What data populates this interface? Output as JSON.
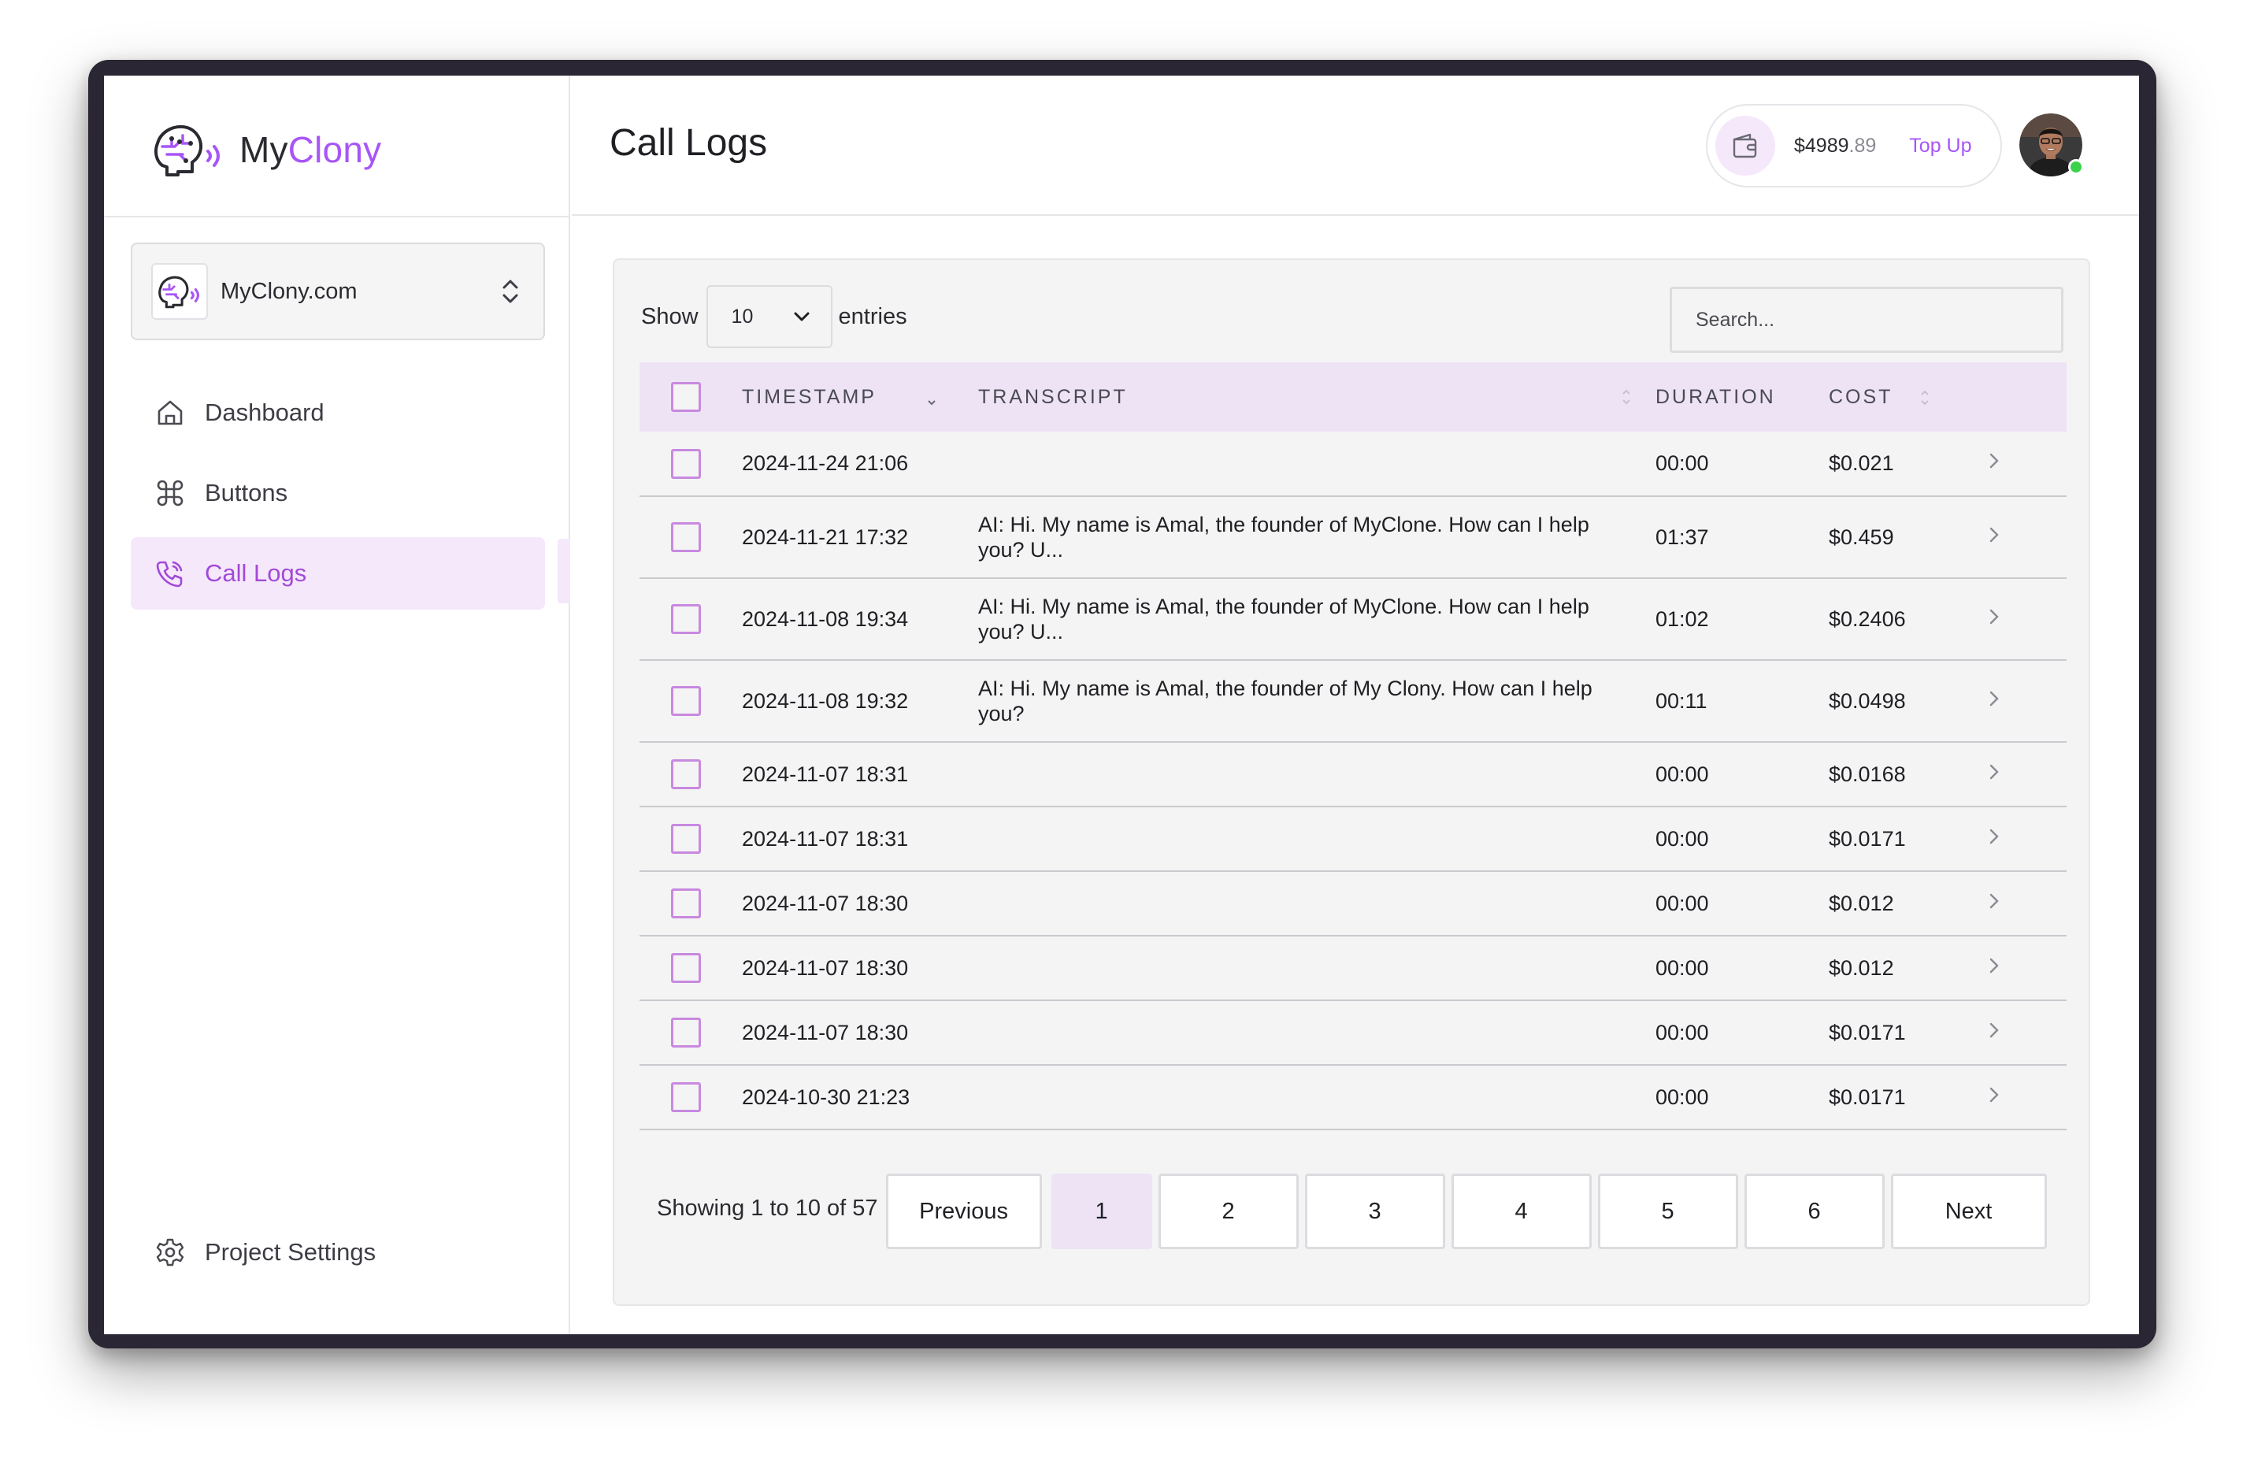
{
  "app": {
    "brand_prefix": "My",
    "brand_suffix": "Clony",
    "accent_color": "#a855f7",
    "active_bg": "#f5e8fb"
  },
  "sidebar": {
    "project_name": "MyClony.com",
    "items": [
      {
        "label": "Dashboard",
        "icon": "home-icon"
      },
      {
        "label": "Buttons",
        "icon": "command-icon"
      },
      {
        "label": "Call Logs",
        "icon": "phone-icon",
        "active": true
      }
    ],
    "settings_label": "Project Settings"
  },
  "header": {
    "title": "Call Logs",
    "balance_main": "$4989",
    "balance_cents": ".89",
    "topup_label": "Top Up"
  },
  "table_controls": {
    "show_label": "Show",
    "entries_value": "10",
    "entries_label": "entries",
    "search_placeholder": "Search..."
  },
  "table": {
    "columns": [
      "TIMESTAMP",
      "TRANSCRIPT",
      "DURATION",
      "COST"
    ],
    "rows": [
      {
        "timestamp": "2024-11-24 21:06",
        "transcript": "",
        "duration": "00:00",
        "cost": "$0.021"
      },
      {
        "timestamp": "2024-11-21 17:32",
        "transcript": "AI: Hi. My name is Amal, the founder of MyClone. How can I help you? U...",
        "duration": "01:37",
        "cost": "$0.459"
      },
      {
        "timestamp": "2024-11-08 19:34",
        "transcript": "AI: Hi. My name is Amal, the founder of MyClone. How can I help you? U...",
        "duration": "01:02",
        "cost": "$0.2406"
      },
      {
        "timestamp": "2024-11-08 19:32",
        "transcript": "AI: Hi. My name is Amal, the founder of My Clony. How can I help you?",
        "duration": "00:11",
        "cost": "$0.0498"
      },
      {
        "timestamp": "2024-11-07 18:31",
        "transcript": "",
        "duration": "00:00",
        "cost": "$0.0168"
      },
      {
        "timestamp": "2024-11-07 18:31",
        "transcript": "",
        "duration": "00:00",
        "cost": "$0.0171"
      },
      {
        "timestamp": "2024-11-07 18:30",
        "transcript": "",
        "duration": "00:00",
        "cost": "$0.012"
      },
      {
        "timestamp": "2024-11-07 18:30",
        "transcript": "",
        "duration": "00:00",
        "cost": "$0.012"
      },
      {
        "timestamp": "2024-11-07 18:30",
        "transcript": "",
        "duration": "00:00",
        "cost": "$0.0171"
      },
      {
        "timestamp": "2024-10-30 21:23",
        "transcript": "",
        "duration": "00:00",
        "cost": "$0.0171"
      }
    ]
  },
  "pagination": {
    "info": "Showing 1 to 10 of 57",
    "previous_label": "Previous",
    "next_label": "Next",
    "pages": [
      "1",
      "2",
      "3",
      "4",
      "5",
      "6"
    ],
    "current": "1"
  }
}
